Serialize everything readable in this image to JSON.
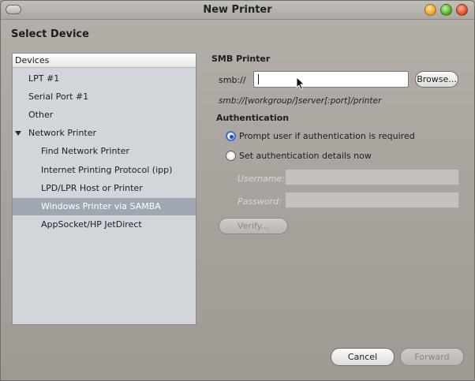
{
  "window": {
    "title": "New Printer"
  },
  "page": {
    "heading": "Select Device"
  },
  "devices": {
    "header": "Devices",
    "items": [
      {
        "label": "LPT #1"
      },
      {
        "label": "Serial Port #1"
      },
      {
        "label": "Other"
      },
      {
        "label": "Network Printer"
      },
      {
        "label": "Find Network Printer"
      },
      {
        "label": "Internet Printing Protocol (ipp)"
      },
      {
        "label": "LPD/LPR Host or Printer"
      },
      {
        "label": "Windows Printer via SAMBA"
      },
      {
        "label": "AppSocket/HP JetDirect"
      }
    ],
    "selected": "Windows Printer via SAMBA"
  },
  "smb": {
    "title": "SMB Printer",
    "prefix": "smb://",
    "value": "",
    "browse_label": "Browse...",
    "hint": "smb://[workgroup/]server[:port]/printer"
  },
  "auth": {
    "title": "Authentication",
    "option_prompt": "Prompt user if authentication is required",
    "option_set": "Set authentication details now",
    "selected_option": "Prompt user if authentication is required",
    "username_label": "Username:",
    "password_label": "Password:",
    "verify_label": "Verify..."
  },
  "footer": {
    "cancel_label": "Cancel",
    "forward_label": "Forward"
  },
  "colors": {
    "selection": "#9fa7b3",
    "radio_accent": "#3d6fd6",
    "window_bg": "#a6a19b"
  }
}
